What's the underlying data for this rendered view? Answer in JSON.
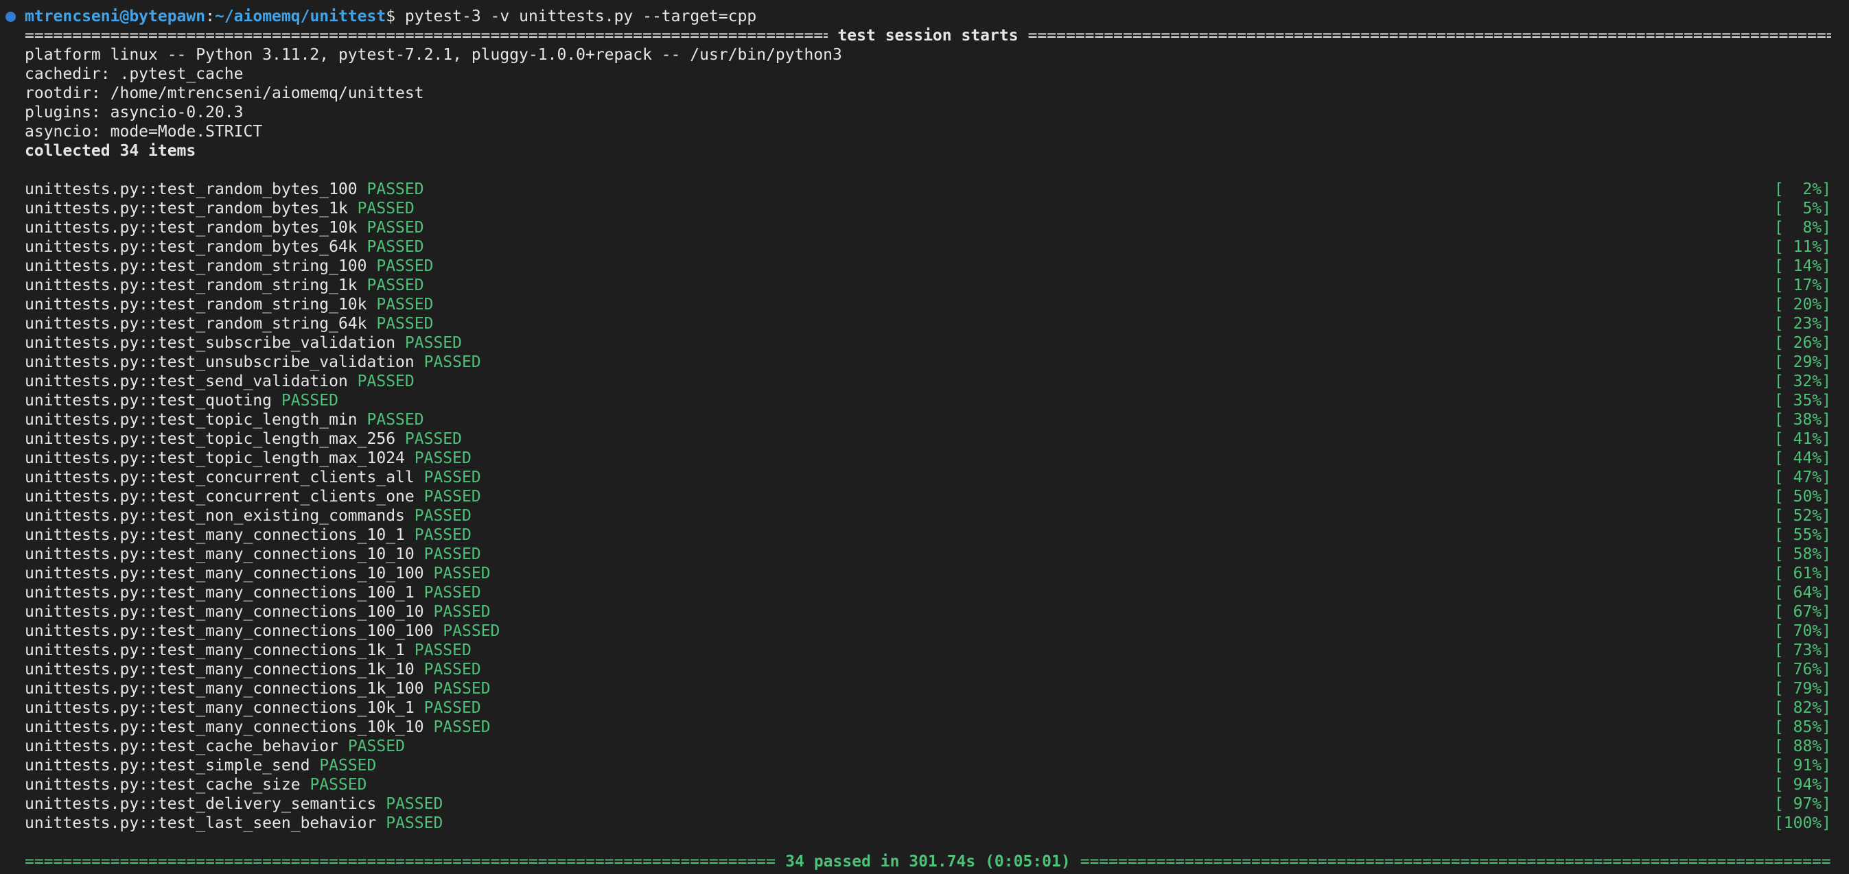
{
  "prompt": {
    "user_host": "mtrencseni@bytepawn",
    "separator": ":",
    "path": "~/aiomemq/unittest",
    "symbol": "$",
    "command": " pytest-3 -v unittests.py --target=cpp"
  },
  "session_header": "test session starts",
  "info_lines": [
    "platform linux -- Python 3.11.2, pytest-7.2.1, pluggy-1.0.0+repack -- /usr/bin/python3",
    "cachedir: .pytest_cache",
    "rootdir: /home/mtrencseni/aiomemq/unittest",
    "plugins: asyncio-0.20.3",
    "asyncio: mode=Mode.STRICT"
  ],
  "collected": "collected 34 items",
  "tests": [
    {
      "name": "unittests.py::test_random_bytes_100",
      "status": "PASSED",
      "progress": "[  2%]"
    },
    {
      "name": "unittests.py::test_random_bytes_1k",
      "status": "PASSED",
      "progress": "[  5%]"
    },
    {
      "name": "unittests.py::test_random_bytes_10k",
      "status": "PASSED",
      "progress": "[  8%]"
    },
    {
      "name": "unittests.py::test_random_bytes_64k",
      "status": "PASSED",
      "progress": "[ 11%]"
    },
    {
      "name": "unittests.py::test_random_string_100",
      "status": "PASSED",
      "progress": "[ 14%]"
    },
    {
      "name": "unittests.py::test_random_string_1k",
      "status": "PASSED",
      "progress": "[ 17%]"
    },
    {
      "name": "unittests.py::test_random_string_10k",
      "status": "PASSED",
      "progress": "[ 20%]"
    },
    {
      "name": "unittests.py::test_random_string_64k",
      "status": "PASSED",
      "progress": "[ 23%]"
    },
    {
      "name": "unittests.py::test_subscribe_validation",
      "status": "PASSED",
      "progress": "[ 26%]"
    },
    {
      "name": "unittests.py::test_unsubscribe_validation",
      "status": "PASSED",
      "progress": "[ 29%]"
    },
    {
      "name": "unittests.py::test_send_validation",
      "status": "PASSED",
      "progress": "[ 32%]"
    },
    {
      "name": "unittests.py::test_quoting",
      "status": "PASSED",
      "progress": "[ 35%]"
    },
    {
      "name": "unittests.py::test_topic_length_min",
      "status": "PASSED",
      "progress": "[ 38%]"
    },
    {
      "name": "unittests.py::test_topic_length_max_256",
      "status": "PASSED",
      "progress": "[ 41%]"
    },
    {
      "name": "unittests.py::test_topic_length_max_1024",
      "status": "PASSED",
      "progress": "[ 44%]"
    },
    {
      "name": "unittests.py::test_concurrent_clients_all",
      "status": "PASSED",
      "progress": "[ 47%]"
    },
    {
      "name": "unittests.py::test_concurrent_clients_one",
      "status": "PASSED",
      "progress": "[ 50%]"
    },
    {
      "name": "unittests.py::test_non_existing_commands",
      "status": "PASSED",
      "progress": "[ 52%]"
    },
    {
      "name": "unittests.py::test_many_connections_10_1",
      "status": "PASSED",
      "progress": "[ 55%]"
    },
    {
      "name": "unittests.py::test_many_connections_10_10",
      "status": "PASSED",
      "progress": "[ 58%]"
    },
    {
      "name": "unittests.py::test_many_connections_10_100",
      "status": "PASSED",
      "progress": "[ 61%]"
    },
    {
      "name": "unittests.py::test_many_connections_100_1",
      "status": "PASSED",
      "progress": "[ 64%]"
    },
    {
      "name": "unittests.py::test_many_connections_100_10",
      "status": "PASSED",
      "progress": "[ 67%]"
    },
    {
      "name": "unittests.py::test_many_connections_100_100",
      "status": "PASSED",
      "progress": "[ 70%]"
    },
    {
      "name": "unittests.py::test_many_connections_1k_1",
      "status": "PASSED",
      "progress": "[ 73%]"
    },
    {
      "name": "unittests.py::test_many_connections_1k_10",
      "status": "PASSED",
      "progress": "[ 76%]"
    },
    {
      "name": "unittests.py::test_many_connections_1k_100",
      "status": "PASSED",
      "progress": "[ 79%]"
    },
    {
      "name": "unittests.py::test_many_connections_10k_1",
      "status": "PASSED",
      "progress": "[ 82%]"
    },
    {
      "name": "unittests.py::test_many_connections_10k_10",
      "status": "PASSED",
      "progress": "[ 85%]"
    },
    {
      "name": "unittests.py::test_cache_behavior",
      "status": "PASSED",
      "progress": "[ 88%]"
    },
    {
      "name": "unittests.py::test_simple_send",
      "status": "PASSED",
      "progress": "[ 91%]"
    },
    {
      "name": "unittests.py::test_cache_size",
      "status": "PASSED",
      "progress": "[ 94%]"
    },
    {
      "name": "unittests.py::test_delivery_semantics",
      "status": "PASSED",
      "progress": "[ 97%]"
    },
    {
      "name": "unittests.py::test_last_seen_behavior",
      "status": "PASSED",
      "progress": "[100%]"
    }
  ],
  "summary": {
    "passed": "34 passed",
    "rest": " in 301.74s (0:05:01)"
  },
  "colors": {
    "background": "#1e1e1e",
    "prompt_blue": "#43a3e8",
    "passed_green": "#4ec078",
    "text": "#e6e6e6"
  }
}
